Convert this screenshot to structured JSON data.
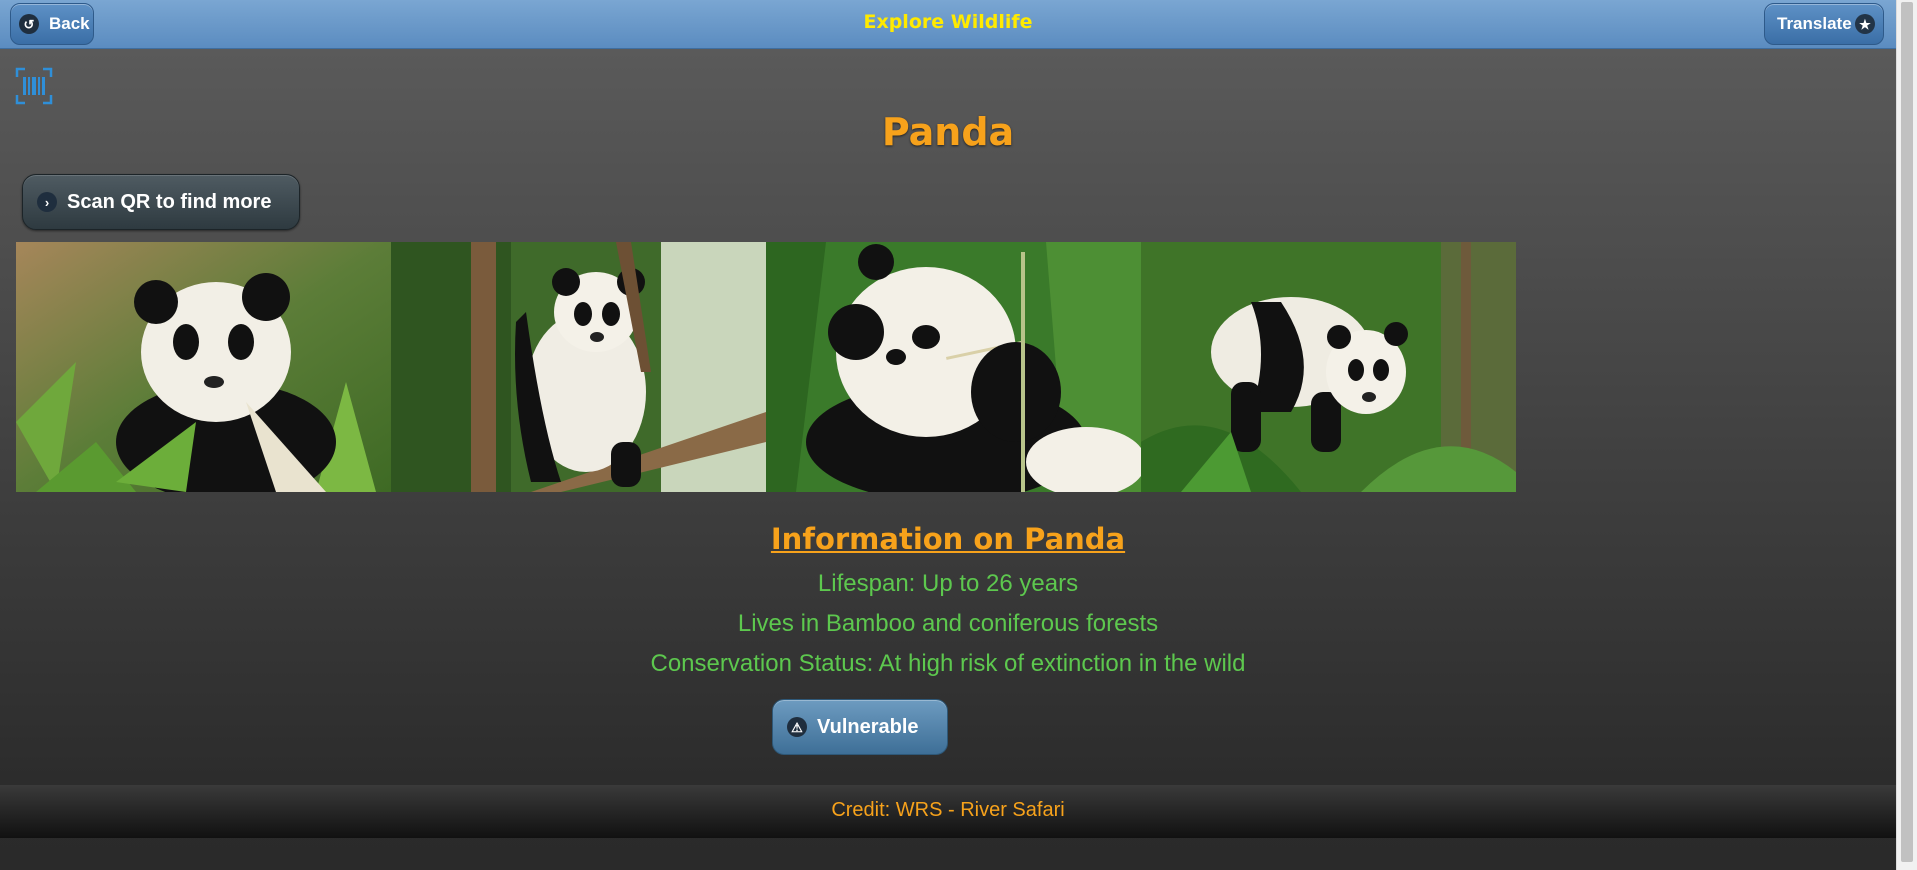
{
  "header": {
    "title": "Explore Wildlife",
    "back_label": "Back",
    "translate_label": "Translate"
  },
  "icons": {
    "back": "back-arrow-icon",
    "translate": "star-icon",
    "barcode": "barcode-scan-icon",
    "scan": "chevron-right-icon",
    "status": "warning-icon"
  },
  "animal": {
    "name": "Panda",
    "scan_label": "Scan QR to find more"
  },
  "gallery": {
    "photos": [
      "panda-photo-1",
      "panda-photo-2",
      "panda-photo-3",
      "panda-photo-4"
    ]
  },
  "info": {
    "heading": "Information on Panda",
    "lifespan": "Lifespan: Up to 26 years",
    "habitat": "Lives in Bamboo and coniferous forests",
    "conservation": "Conservation Status: At high risk of extinction in the wild",
    "status_label": "Vulnerable"
  },
  "footer": {
    "credit": "Credit: WRS - River Safari"
  },
  "colors": {
    "header_title": "#ffea00",
    "accent_orange": "#f7a21b",
    "info_green": "#5dc84e",
    "header_blue": "#5b8cc0"
  }
}
